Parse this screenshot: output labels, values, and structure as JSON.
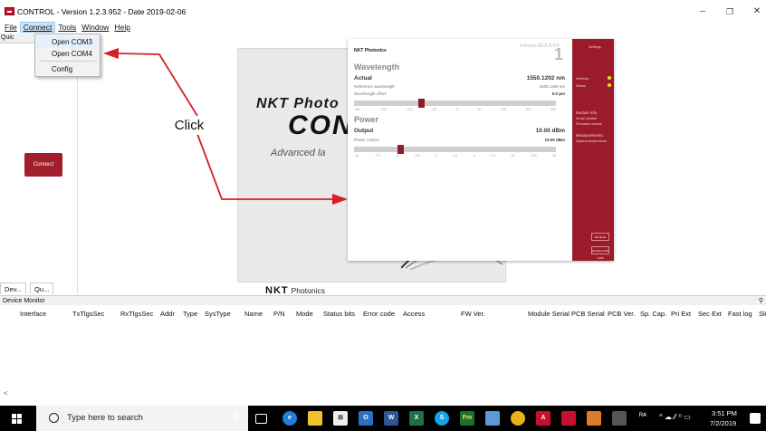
{
  "window": {
    "title": "CONTROL - Version 1.2.3.952 - Date 2019-02-06",
    "minimize": "–",
    "restore": "❐",
    "close": "✕"
  },
  "menu": {
    "items": [
      "File",
      "Connect",
      "Tools",
      "Window",
      "Help"
    ],
    "active_index": 1
  },
  "connect_menu": {
    "items": [
      "Open COM3",
      "Open COM4",
      "Config"
    ]
  },
  "left_panel": {
    "tab_quick": "Quic",
    "tab_home": "ome",
    "connect_button": "Connect",
    "bottom_tabs": [
      "Dev...",
      "Qu..."
    ]
  },
  "splash": {
    "brand": "NKT Photo",
    "product": "CON",
    "subtitle": "Advanced la",
    "logo_mark": "NKT",
    "logo_text": "Photonics"
  },
  "annotation": {
    "label": "Click"
  },
  "control_screenshot": {
    "brand": "NKT Photonics",
    "device_label": "Koheras ADJUSTIK",
    "device_number": "1",
    "wavelength": {
      "title": "Wavelength",
      "actual_label": "Actual",
      "actual_value": "1550.1202 nm",
      "reference_label": "Reference wavelength",
      "reference_value": "1550.1199 nm",
      "offset_label": "Wavelength offset",
      "offset_value": "0.0 pm",
      "offset_fraction": 0.33,
      "scale": [
        "-300",
        "-200",
        "-100",
        "-50",
        "0",
        "50",
        "100",
        "200",
        "300"
      ]
    },
    "power": {
      "title": "Power",
      "output_label": "Output",
      "output_value": "10.00 dBm",
      "control_label": "Power control",
      "control_value": "10.00 dBm",
      "control_fraction": 0.22,
      "scale": [
        "-10",
        "-7.5",
        "-5",
        "-2.5",
        "0",
        "2.5",
        "5",
        "7.5",
        "10",
        "12.5",
        "15"
      ]
    },
    "side": {
      "settings": "Settings",
      "interlock": "Interlock",
      "status": "Status",
      "module_info": "Module info",
      "serial_label": "Serial number",
      "serial_value": "19000000",
      "firmware_label": "Firmware version",
      "firmware_value": "1.07 Nov 19 2018",
      "measurements": "Measurements",
      "temp_label": "System temperature",
      "temp_value": "30.5 °C",
      "btn1": "BH Mode",
      "btn2": "Emission ON / OFF"
    },
    "indicator_color": "#e5df2a",
    "accent_color": "#9b1b2a"
  },
  "device_monitor": {
    "title": "Device Monitor",
    "pin": "⚲",
    "columns": [
      "Interface",
      "TxTlgsSec",
      "RxTlgsSec",
      "Addr",
      "Type",
      "SysType",
      "Name",
      "P/N",
      "Mode",
      "Status bits",
      "Error code",
      "Access",
      "FW Ver.",
      "Module Serial",
      "PCB Serial",
      "PCB Ver.",
      "Sp. Cap.",
      "Pri Ext",
      "Sec Ext",
      "Fast log",
      "Slo"
    ],
    "scroll": "<"
  },
  "taskbar": {
    "search_placeholder": "Type here to search",
    "time": "3:51 PM",
    "date": "7/2/2019",
    "tray_user": "ᴿᴬ",
    "tray_icons": "^ ☁ ⁄⁄ ⁾⁾ ▭"
  }
}
